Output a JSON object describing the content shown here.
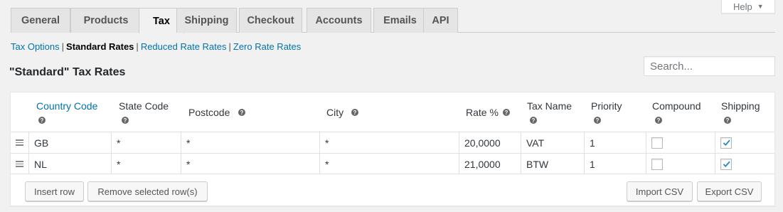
{
  "help": {
    "label": "Help",
    "caret": "▼"
  },
  "tabs": [
    {
      "label": "General"
    },
    {
      "label": "Products"
    },
    {
      "label": "Tax"
    },
    {
      "label": "Shipping"
    },
    {
      "label": "Checkout"
    },
    {
      "label": "Accounts"
    },
    {
      "label": "Emails"
    },
    {
      "label": "API"
    }
  ],
  "active_tab": "Tax",
  "subnav": {
    "tax_options": "Tax Options",
    "standard_rates": "Standard Rates",
    "reduced_rates": "Reduced Rate Rates",
    "zero_rates": "Zero Rate Rates",
    "separator": "|"
  },
  "page_title": "\"Standard\" Tax Rates",
  "search": {
    "placeholder": "Search..."
  },
  "table": {
    "columns": [
      {
        "label": "Country Code"
      },
      {
        "label": "State Code"
      },
      {
        "label": "Postcode"
      },
      {
        "label": "City"
      },
      {
        "label": "Rate %"
      },
      {
        "label": "Tax Name"
      },
      {
        "label": "Priority"
      },
      {
        "label": "Compound"
      },
      {
        "label": "Shipping"
      }
    ],
    "help_glyph": "?",
    "rows": [
      {
        "country": "GB",
        "state": "*",
        "postcode": "*",
        "city": "*",
        "rate": "20,0000",
        "name": "VAT",
        "priority": "1",
        "compound": false,
        "shipping": true
      },
      {
        "country": "NL",
        "state": "*",
        "postcode": "*",
        "city": "*",
        "rate": "21,0000",
        "name": "BTW",
        "priority": "1",
        "compound": false,
        "shipping": true
      }
    ]
  },
  "buttons": {
    "insert_row": "Insert row",
    "remove_rows": "Remove selected row(s)",
    "import_csv": "Import CSV",
    "export_csv": "Export CSV"
  },
  "colors": {
    "link": "#0073aa",
    "checkmark": "#1e8cbe"
  }
}
